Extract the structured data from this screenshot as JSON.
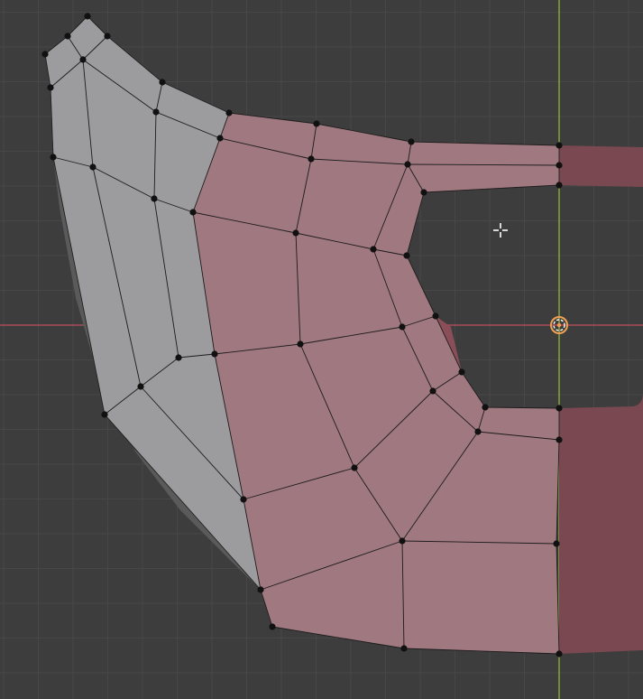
{
  "viewport": {
    "background": "#3d3d3d",
    "grid_minor_color": "#474747",
    "grid_major_color": "#4f4f4f",
    "x_axis_color": "#c0505f",
    "y_axis_color": "#8fb43a"
  },
  "mesh": {
    "unselected_face_color": "#9c9c9e",
    "selected_face_color": "#a07880",
    "mirror_face_color": "#7a4850",
    "edge_color": "#1c1c1c",
    "vertex_color": "#111111",
    "shadow_color": "#2e2e2e"
  },
  "gizmos": {
    "origin_icon": "object-origin-icon",
    "cursor_icon": "crosshair-cursor-icon",
    "origin_ring_color": "#f0a050",
    "cursor_color": "#ffffff"
  }
}
